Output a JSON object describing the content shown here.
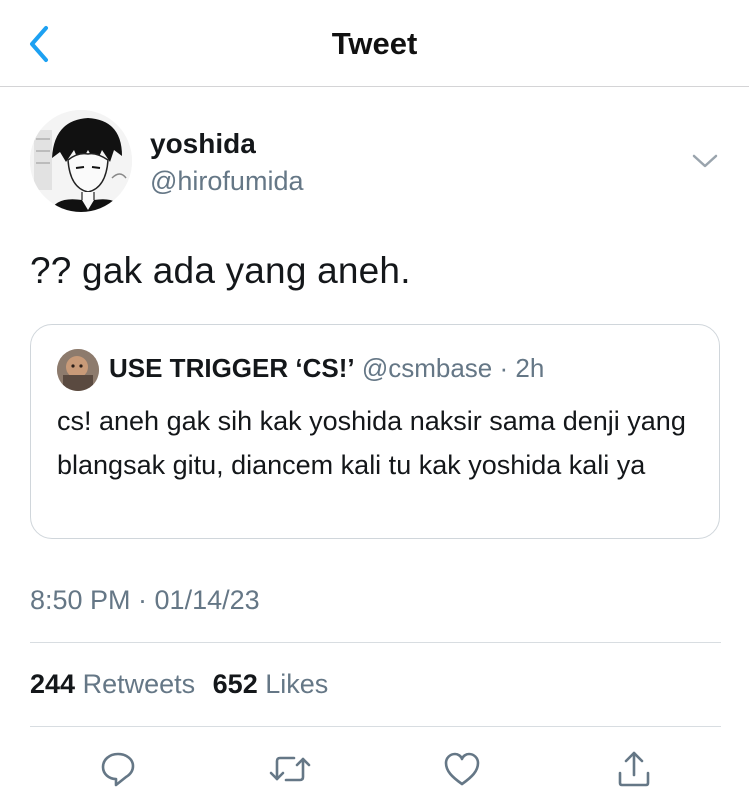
{
  "header": {
    "title": "Tweet",
    "back_icon": "chevron-left-icon"
  },
  "author": {
    "name": "yoshida",
    "handle": "@hirofumida"
  },
  "tweet": {
    "text": "?? gak ada yang aneh.",
    "timestamp": "8:50 PM · 01/14/23"
  },
  "quoted": {
    "name": "USE TRIGGER ‘CS!’",
    "handle": "@csmbase",
    "dot": "·",
    "time": "2h",
    "text": "cs! aneh gak sih kak yoshida naksir sama denji yang blangsak gitu, diancem kali tu kak yoshida kali ya"
  },
  "stats": {
    "retweets_count": "244",
    "retweets_label": "Retweets",
    "likes_count": "652",
    "likes_label": "Likes"
  },
  "actions": [
    "reply-icon",
    "retweet-icon",
    "like-icon",
    "share-icon"
  ],
  "colors": {
    "accent": "#1DA1F2",
    "secondary_text": "#657786",
    "primary_text": "#14171A",
    "divider": "#D8DDE1"
  }
}
